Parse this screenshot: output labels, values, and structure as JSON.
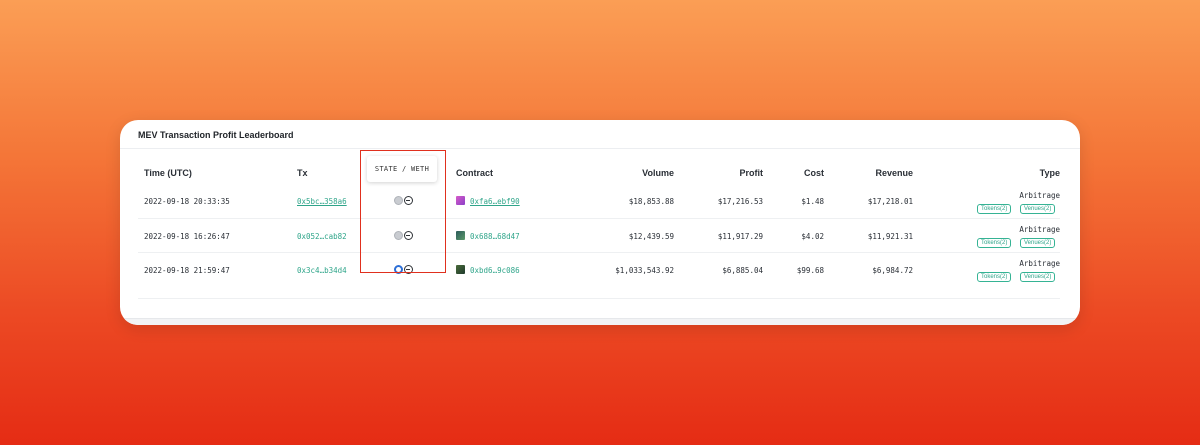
{
  "board": {
    "title": "MEV Transaction Profit Leaderboard"
  },
  "columns": {
    "time": "Time (UTC)",
    "tx": "Tx",
    "contract": "Contract",
    "volume": "Volume",
    "profit": "Profit",
    "cost": "Cost",
    "revenue": "Revenue",
    "type": "Type"
  },
  "tooltip": {
    "text": "STATE / WETH"
  },
  "rows": [
    {
      "time": "2022-09-18 20:33:35",
      "tx": "0x5bc…358a6",
      "contract": "0xfa6…ebf90",
      "volume": "$18,853.88",
      "profit": "$17,216.53",
      "cost": "$1.48",
      "revenue": "$17,218.01",
      "type": "Arbitrage",
      "tag_tokens": "Tokens(2)",
      "tag_venues": "Venues(2)"
    },
    {
      "time": "2022-09-18 16:26:47",
      "tx": "0x052…cab82",
      "contract": "0x688…68d47",
      "volume": "$12,439.59",
      "profit": "$11,917.29",
      "cost": "$4.02",
      "revenue": "$11,921.31",
      "type": "Arbitrage",
      "tag_tokens": "Tokens(2)",
      "tag_venues": "Venues(2)"
    },
    {
      "time": "2022-09-18 21:59:47",
      "tx": "0x3c4…b34d4",
      "contract": "0xbd6…9c086",
      "volume": "$1,033,543.92",
      "profit": "$6,885.04",
      "cost": "$99.68",
      "revenue": "$6,984.72",
      "type": "Arbitrage",
      "tag_tokens": "Tokens(2)",
      "tag_venues": "Venues(2)"
    }
  ]
}
